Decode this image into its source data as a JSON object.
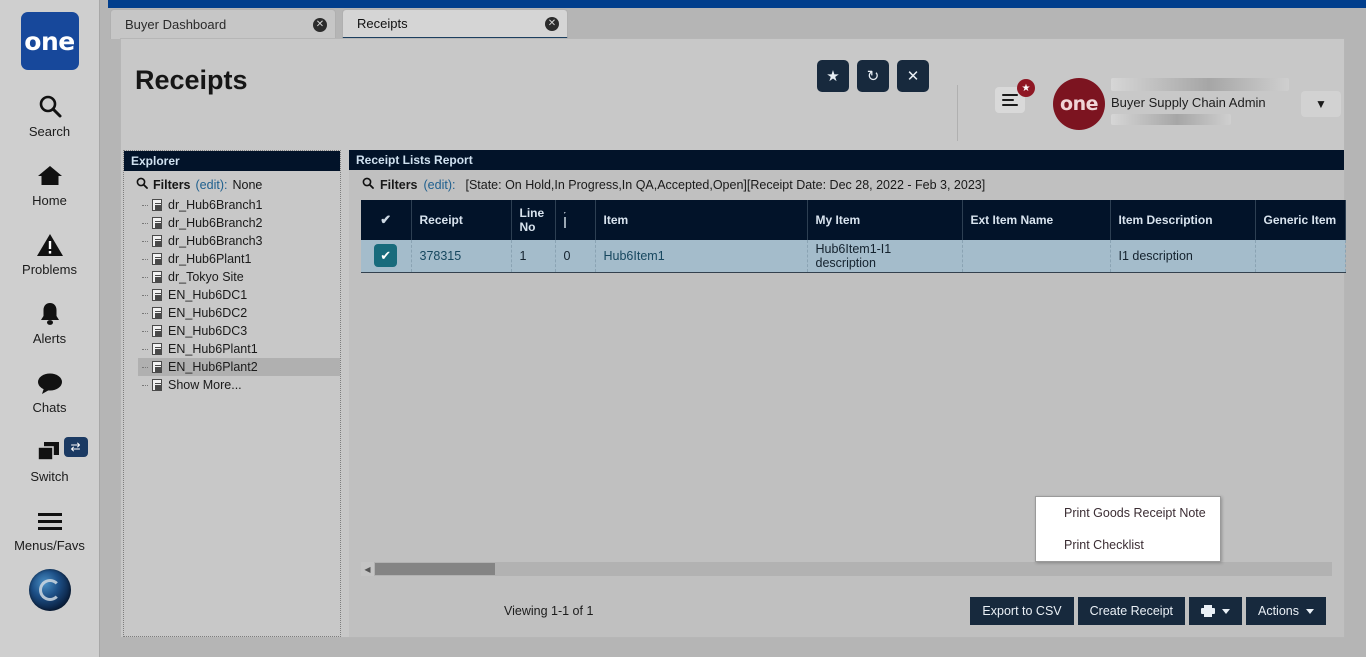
{
  "brand": {
    "logo_text": "one",
    "accent_blue": "#17489b",
    "avatar_red": "#7c1420",
    "panel_navy": "#021329"
  },
  "left_rail": {
    "items": [
      {
        "label": "Search",
        "icon": "search-icon"
      },
      {
        "label": "Home",
        "icon": "home-icon"
      },
      {
        "label": "Problems",
        "icon": "warning-triangle-icon"
      },
      {
        "label": "Alerts",
        "icon": "bell-icon"
      },
      {
        "label": "Chats",
        "icon": "chat-bubble-icon"
      },
      {
        "label": "Switch",
        "icon": "windows-stack-icon",
        "badge_icon": "swap-arrows-icon"
      },
      {
        "label": "Menus/Favs",
        "icon": "hamburger-icon"
      }
    ],
    "orb_icon": "globe-orb-icon"
  },
  "tabs": [
    {
      "label": "Buyer Dashboard",
      "active": false,
      "close_icon": "close-circle-icon"
    },
    {
      "label": "Receipts",
      "active": true,
      "close_icon": "close-circle-icon"
    }
  ],
  "header": {
    "title": "Receipts",
    "actions": [
      {
        "name": "favorite-button",
        "icon": "star-icon",
        "glyph": "★"
      },
      {
        "name": "refresh-button",
        "icon": "refresh-icon",
        "glyph": "↻"
      },
      {
        "name": "close-button",
        "icon": "close-x-icon",
        "glyph": "✕"
      }
    ],
    "menus_favs_icon": "hamburger-icon",
    "favs_badge_icon": "star-icon",
    "favs_badge_glyph": "★",
    "user_name": "Buyer Supply Chain Admin",
    "user_caret_glyph": "⌄"
  },
  "explorer": {
    "title": "Explorer",
    "filters_label": "Filters",
    "filters_edit": "(edit):",
    "filters_value": "None",
    "search_icon": "magnifier-icon",
    "nodes": [
      {
        "label": "dr_Hub6Branch1",
        "selected": false
      },
      {
        "label": "dr_Hub6Branch2",
        "selected": false
      },
      {
        "label": "dr_Hub6Branch3",
        "selected": false
      },
      {
        "label": "dr_Hub6Plant1",
        "selected": false
      },
      {
        "label": "dr_Tokyo Site",
        "selected": false
      },
      {
        "label": "EN_Hub6DC1",
        "selected": false
      },
      {
        "label": "EN_Hub6DC2",
        "selected": false
      },
      {
        "label": "EN_Hub6DC3",
        "selected": false
      },
      {
        "label": "EN_Hub6Plant1",
        "selected": false
      },
      {
        "label": "EN_Hub6Plant2",
        "selected": true
      },
      {
        "label": "Show More...",
        "selected": false
      }
    ]
  },
  "report": {
    "title": "Receipt Lists Report",
    "filters_label": "Filters",
    "filters_edit": "(edit):",
    "filters_value": "[State: On Hold,In Progress,In QA,Accepted,Open][Receipt Date: Dec 28, 2022 - Feb 3, 2023]",
    "search_icon": "magnifier-icon",
    "columns": [
      {
        "key": "check",
        "label": "",
        "icon": "checkmark-icon"
      },
      {
        "key": "receipt",
        "label": "Receipt"
      },
      {
        "key": "line_no",
        "label": "Line No"
      },
      {
        "key": "doc",
        "label": "",
        "icon": "document-icon"
      },
      {
        "key": "item",
        "label": "Item"
      },
      {
        "key": "my_item",
        "label": "My Item"
      },
      {
        "key": "ext_item_name",
        "label": "Ext Item Name"
      },
      {
        "key": "item_description",
        "label": "Item Description"
      },
      {
        "key": "generic_item",
        "label": "Generic Item"
      }
    ],
    "rows": [
      {
        "selected": true,
        "check_icon": "checkmark-icon",
        "receipt": "378315",
        "line_no": "1",
        "doc": "0",
        "item": "Hub6Item1",
        "my_item": "Hub6Item1-I1 description",
        "ext_item_name": "",
        "item_description": "I1 description",
        "generic_item": ""
      }
    ],
    "scroll_left_icon": "caret-left-icon"
  },
  "footer": {
    "viewing_text": "Viewing 1-1 of 1",
    "export_label": "Export to CSV",
    "create_label": "Create Receipt",
    "print_icon": "printer-icon",
    "actions_label": "Actions"
  },
  "print_menu": {
    "items": [
      {
        "label": "Print Goods Receipt Note"
      },
      {
        "label": "Print Checklist"
      }
    ]
  }
}
